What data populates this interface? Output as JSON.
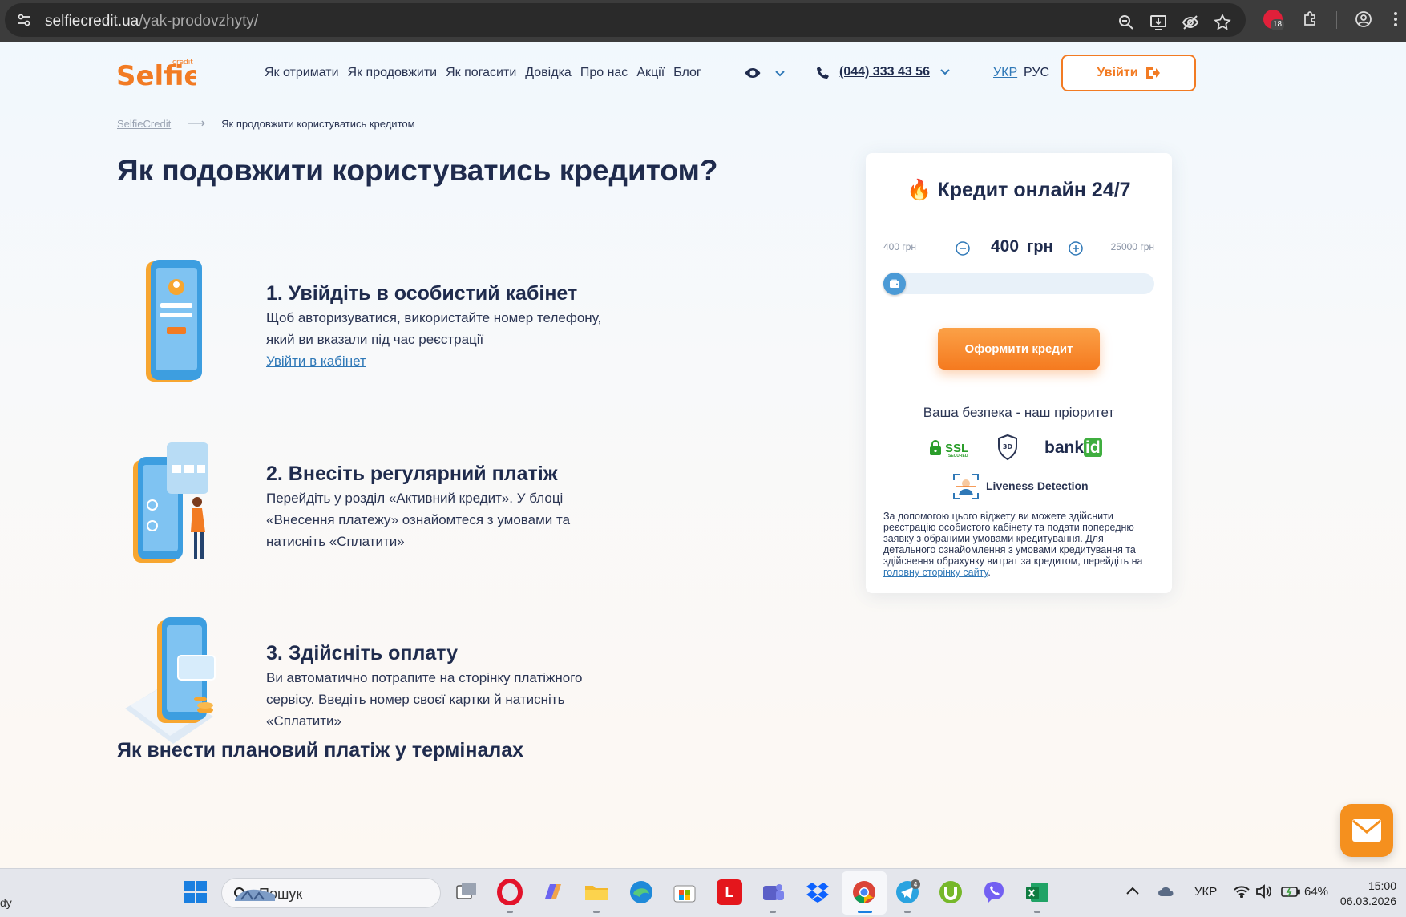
{
  "browser": {
    "url_host": "selfiecredit.ua",
    "url_path": "/yak-prodovzhyty/",
    "extension_badge": "18"
  },
  "header": {
    "logo": "Selfie",
    "logo_sup": "credit",
    "nav": [
      "Як отримати",
      "Як продовжити",
      "Як погасити",
      "Довідка",
      "Про нас",
      "Акції",
      "Блог"
    ],
    "phone": "(044) 333 43 56",
    "lang_ukr": "УКР",
    "lang_rus": "РУС",
    "login": "Увійти"
  },
  "breadcrumb": {
    "home": "SelfieCredit",
    "current": "Як продовжити користуватись кредитом"
  },
  "page_title": "Як подовжити користуватись кредитом?",
  "steps": [
    {
      "title": "1. Увійдіть в особистий кабінет",
      "text": "Щоб авторизуватися, використайте номер телефону, який ви вказали під час реєстрації",
      "link": "Увійти в кабінет"
    },
    {
      "title": "2. Внесіть регулярний платіж",
      "text": "Перейдіть у розділ «Активний кредит». У блоці «Внесення платежу» ознайомтеся з умовами та натисніть «Сплатити»"
    },
    {
      "title": "3. Здійсніть оплату",
      "text": "Ви автоматично потрапите на сторінку платіжного сервісу. Введіть номер своєї картки й натисніть «Сплатити»"
    }
  ],
  "section_title": "Як внести плановий платіж у терміналах",
  "widget": {
    "fire": "🔥",
    "title": "Кредит онлайн 24/7",
    "min_label": "400 грн",
    "max_label": "25000 грн",
    "amount": "400",
    "amount_unit": "грн",
    "slider_min": 400,
    "slider_max": 25000,
    "slider_value": 400,
    "cta": "Оформити кредит",
    "security_title": "Ваша безпека - наш пріоритет",
    "ssl": "SSL",
    "ssl_sub": "SECURED",
    "secure3d": "3D",
    "bankid_a": "bank",
    "bankid_b": "id",
    "liveness": "Liveness Detection",
    "note_text": "За допомогою цього віджету ви можете здійснити реєстрацію особистого кабінету та подати попередню заявку з обраними умовами кредитування. Для детального ознайомлення з умовами кредитування та здійснення обрахунку витрат за кредитом, перейдіть на ",
    "note_link": "головну сторінку сайту",
    "note_end": "."
  },
  "taskbar": {
    "edge_text": "dy",
    "search_placeholder": "Пошук",
    "lang": "УКР",
    "battery": "64%",
    "time": "15:00",
    "date": "06.03.2026",
    "telegram_badge": "4",
    "app_letter_l": "L"
  },
  "colors": {
    "accent_orange": "#f27b23",
    "accent_blue": "#2f78b7",
    "text_dark": "#1f2b4d"
  }
}
